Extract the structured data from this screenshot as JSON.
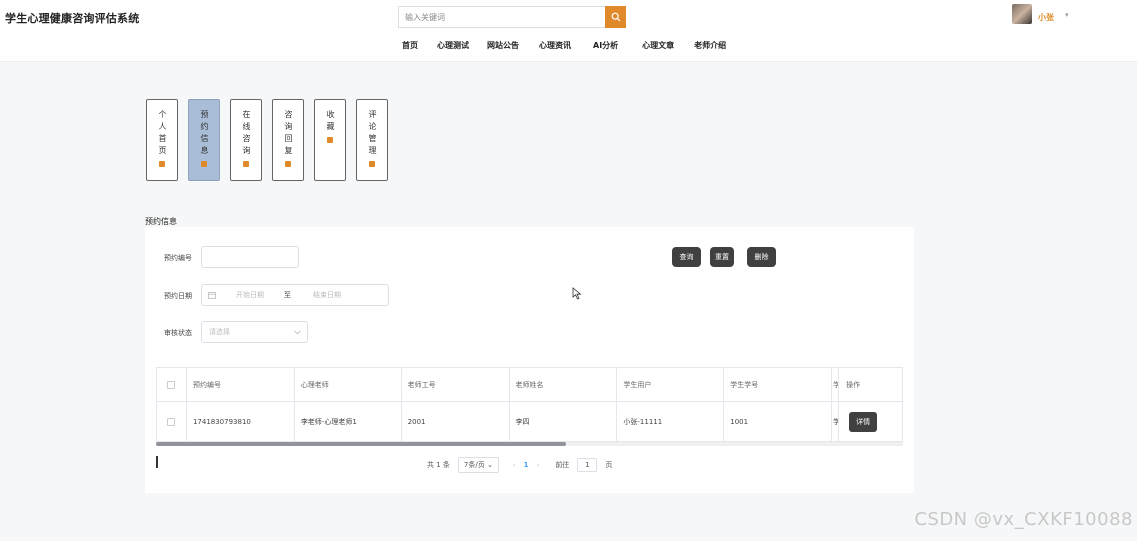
{
  "header": {
    "site_title": "学生心理健康咨询评估系统",
    "search_placeholder": "输入关键词",
    "user_name": "小张",
    "user_caret": "▾"
  },
  "nav": {
    "items": [
      "首页",
      "心理测试",
      "网站公告",
      "心理资讯",
      "AI分析",
      "心理文章",
      "老师介绍"
    ]
  },
  "side_tabs": [
    {
      "label": "个人首页",
      "active": false
    },
    {
      "label": "预约信息",
      "active": true
    },
    {
      "label": "在线咨询",
      "active": false
    },
    {
      "label": "咨询回复",
      "active": false
    },
    {
      "label": "收藏",
      "active": false
    },
    {
      "label": "评论管理",
      "active": false
    }
  ],
  "section_title": "预约信息",
  "filters": {
    "booking_no_label": "预约编号",
    "date_label": "预约日期",
    "date_start_placeholder": "开始日期",
    "date_sep": "至",
    "date_end_placeholder": "结束日期",
    "status_label": "审核状态",
    "status_placeholder": "请选择"
  },
  "actions": {
    "query": "查询",
    "reset": "重置",
    "delete": "删除"
  },
  "table": {
    "headers": [
      "预约编号",
      "心理老师",
      "老师工号",
      "老师姓名",
      "学生用户",
      "学生学号",
      "学",
      "操作"
    ],
    "rows": [
      {
        "booking_no": "1741830793810",
        "teacher": "李老师-心理老师1",
        "teacher_id": "2001",
        "teacher_name": "李四",
        "student": "小张-11111",
        "student_no": "1001",
        "extra": "学",
        "op": "详情"
      }
    ]
  },
  "pagination": {
    "total": "共 1 条",
    "page_size": "7条/页",
    "prev": "‹",
    "current": "1",
    "next": "›",
    "goto_label": "前往",
    "goto_value": "1",
    "page_unit": "页"
  },
  "watermark": "CSDN @vx_CXKF10088"
}
